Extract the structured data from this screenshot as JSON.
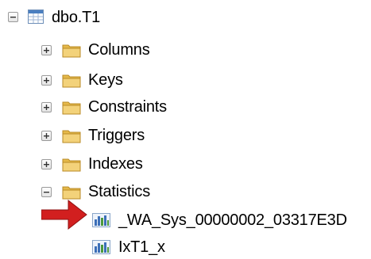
{
  "tree": {
    "root": {
      "label": "dbo.T1",
      "icon": "table-icon",
      "expanded": true
    },
    "folders": [
      {
        "label": "Columns",
        "icon": "folder-icon",
        "expanded": false
      },
      {
        "label": "Keys",
        "icon": "folder-icon",
        "expanded": false
      },
      {
        "label": "Constraints",
        "icon": "folder-icon",
        "expanded": false
      },
      {
        "label": "Triggers",
        "icon": "folder-icon",
        "expanded": false
      },
      {
        "label": "Indexes",
        "icon": "folder-icon",
        "expanded": false
      },
      {
        "label": "Statistics",
        "icon": "folder-icon",
        "expanded": true
      }
    ],
    "statistics": [
      {
        "label": "_WA_Sys_00000002_03317E3D",
        "icon": "statistics-icon"
      },
      {
        "label": "IxT1_x",
        "icon": "statistics-icon"
      }
    ]
  },
  "annotation": {
    "icon": "red-arrow-icon",
    "color": "#d21f1f"
  },
  "colors": {
    "folder": "#f3d27a",
    "table_header": "#4a7fc1",
    "stat_bar": "#3c6fb8"
  }
}
